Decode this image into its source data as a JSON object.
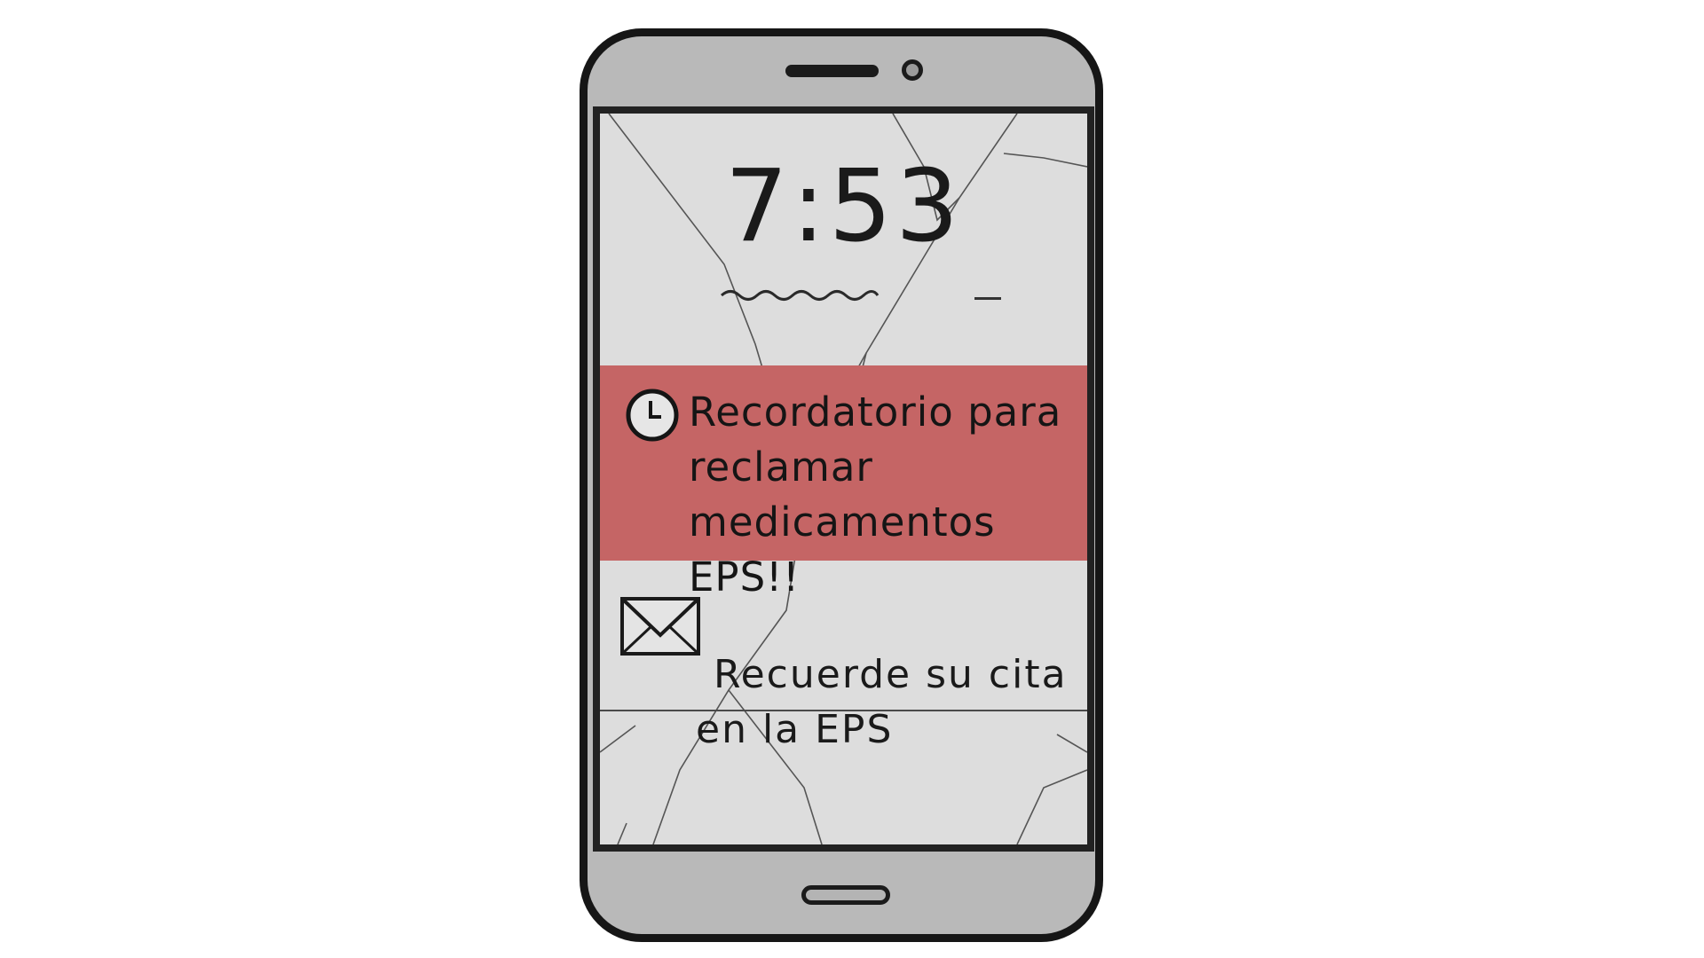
{
  "lock_screen": {
    "time": "7:53"
  },
  "notifications": [
    {
      "icon": "clock-icon",
      "text": "Recordatorio para\nreclamar medicamentos\nEPS!!",
      "highlight_color": "#c56565"
    },
    {
      "icon": "envelope-icon",
      "text_line1": "Recuerde su cita",
      "text_line2": "en la EPS"
    }
  ],
  "colors": {
    "phone_body": "#b9b9b9",
    "screen": "#dddddd",
    "outline": "#161616"
  }
}
